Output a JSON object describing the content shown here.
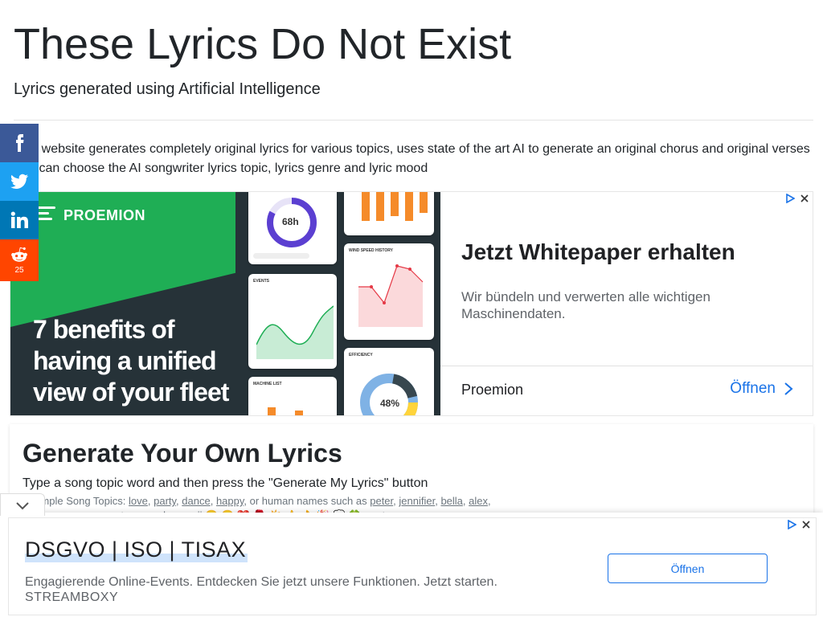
{
  "header": {
    "title": "These Lyrics Do Not Exist",
    "subtitle": "Lyrics generated using Artificial Intelligence"
  },
  "intro": {
    "line1": "This website generates completely original lyrics for various topics, uses state of the art AI to generate an original chorus and original verses",
    "line2": "You can choose the AI songwriter lyrics topic, lyrics genre and lyric mood"
  },
  "share": {
    "facebook": "facebook-icon",
    "twitter": "twitter-icon",
    "linkedin": "linkedin-icon",
    "reddit": "reddit-icon",
    "reddit_count": "25"
  },
  "ad_top": {
    "logo_text": "PROEMION",
    "headline": "7 benefits of having a unified view of your fleet",
    "dash_gauge_value": "68h",
    "dash_events_label": "EVENTS",
    "dash_wind_label": "WIND SPEED HISTORY",
    "dash_efficiency_label": "EFFICIENCY",
    "dash_efficiency_value": "48%",
    "dash_machine_label": "MACHINE LIST",
    "title": "Jetzt Whitepaper erhalten",
    "description": "Wir bündeln und verwerten alle wichtigen Maschinendaten.",
    "brand": "Proemion",
    "cta": "Öffnen",
    "colors": {
      "green": "#1fae55",
      "dark": "#263238",
      "cta": "#1a73e8",
      "gauge": "#5b3fd1",
      "bars": "#f58b2a"
    }
  },
  "generator": {
    "title": "Generate Your Own Lyrics",
    "instruction": "Type a song topic word and then press the \"Generate My Lyrics\" button",
    "examples_prefix": "Example Song Topics:",
    "topics": [
      "love",
      "party",
      "dance",
      "happy"
    ],
    "names_prefix": ", or human names such as",
    "names": [
      "peter",
      "jennifier",
      "bella",
      "alex"
    ],
    "emoji_line": "You can even generate songs by emoji 😊 😎 ❤️ 🌹 ☀️ 👍 👌 🎉 💭 🍀 or etc."
  },
  "ad_bottom": {
    "title": "DSGVO | ISO | TISAX",
    "description": "Engagierende Online-Events. Entdecken Sie jetzt unsere Funktionen. Jetzt starten.",
    "brand": "STREAMBOXY",
    "cta": "Öffnen"
  }
}
